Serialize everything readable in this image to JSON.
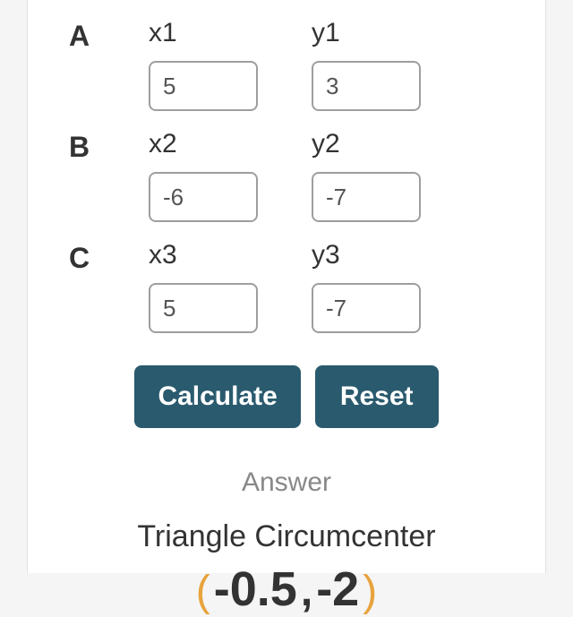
{
  "points": {
    "A": {
      "label": "A",
      "x": {
        "label": "x1",
        "value": "5"
      },
      "y": {
        "label": "y1",
        "value": "3"
      }
    },
    "B": {
      "label": "B",
      "x": {
        "label": "x2",
        "value": "-6"
      },
      "y": {
        "label": "y2",
        "value": "-7"
      }
    },
    "C": {
      "label": "C",
      "x": {
        "label": "x3",
        "value": "5"
      },
      "y": {
        "label": "y3",
        "value": "-7"
      }
    }
  },
  "buttons": {
    "calculate": "Calculate",
    "reset": "Reset"
  },
  "answer": {
    "label": "Answer",
    "title": "Triangle Circumcenter",
    "paren_open": "(",
    "paren_close": ")",
    "x": "-0.5",
    "comma": ",",
    "y": "-2"
  }
}
